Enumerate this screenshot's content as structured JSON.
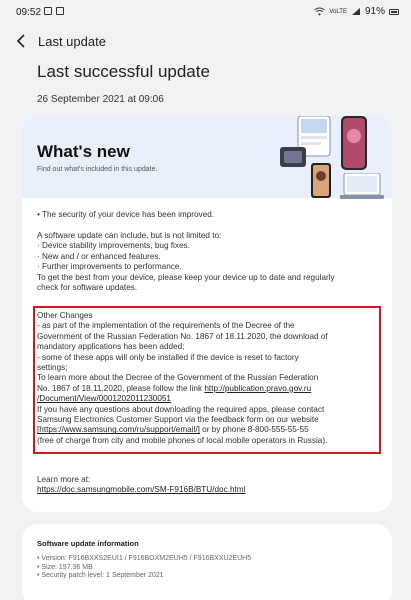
{
  "status_bar": {
    "time": "09:52",
    "network_label": "VoLTE",
    "battery": "91%"
  },
  "header": {
    "title": "Last update",
    "back_icon": "chevron-left-icon"
  },
  "page": {
    "title": "Last successful update",
    "date": "26 September 2021 at 09:06"
  },
  "whats_new": {
    "title": "What's new",
    "subtitle": "Find out what's included in this update.",
    "intro": "• The security of your device has been improved.",
    "update_text": [
      "A software update can include, but is not limited to:",
      " · Device stability improvements, bug fixes.",
      " · New and / or enhanced features.",
      " · Further improvements to performance.",
      "To get the best from your device, please keep your device up to date and regularly",
      "check for software updates."
    ],
    "other_changes": {
      "line1": "Other Changes",
      "line2": "- as part of the implementation of the requirements of the Decree of the",
      "line3": "Government of the Russian Federation No. 1867 of 18.11.2020, the download of",
      "line4": "mandatory applications has been added;",
      "line5": "- some of these apps will only be installed if the device is reset to factory",
      "line6": "settings;",
      "line7": "To learn more about the Decree of the Government of the Russian Federation",
      "line8_text": "No. 1867 of 18.11.2020, please follow the link ",
      "line8_link": "http://publication.pravo.gov.ru",
      "line9_link": "/Document/View/0001202011230051",
      "line10": "If you have any questions about downloading the required apps, please contact",
      "line11": "Samsung Electronics Customer Support via the feedback form on our website",
      "line12_link": "[https://www.samsung.com/ru/support/email/]",
      "line12_text": " or by phone 8-800-555-55-55",
      "line13": "(free of charge from city and mobile phones of local mobile operators in Russia)."
    },
    "learn_more_label": "Learn more at:",
    "learn_more_link": "https://doc.samsungmobile.com/SM-F916B/BTU/doc.html"
  },
  "software_info": {
    "title": "Software update information",
    "version": "• Version: F916BXXS2EUI1 / F916BOXM2EUH5 / F916BXXU2EUH5",
    "size": "• Size: 197.36 MB",
    "security_patch": "• Security patch level: 1 September 2021"
  },
  "colors": {
    "background": "#f2f2f4",
    "banner": "#e9f0fb",
    "highlight_border": "#d7161c"
  }
}
